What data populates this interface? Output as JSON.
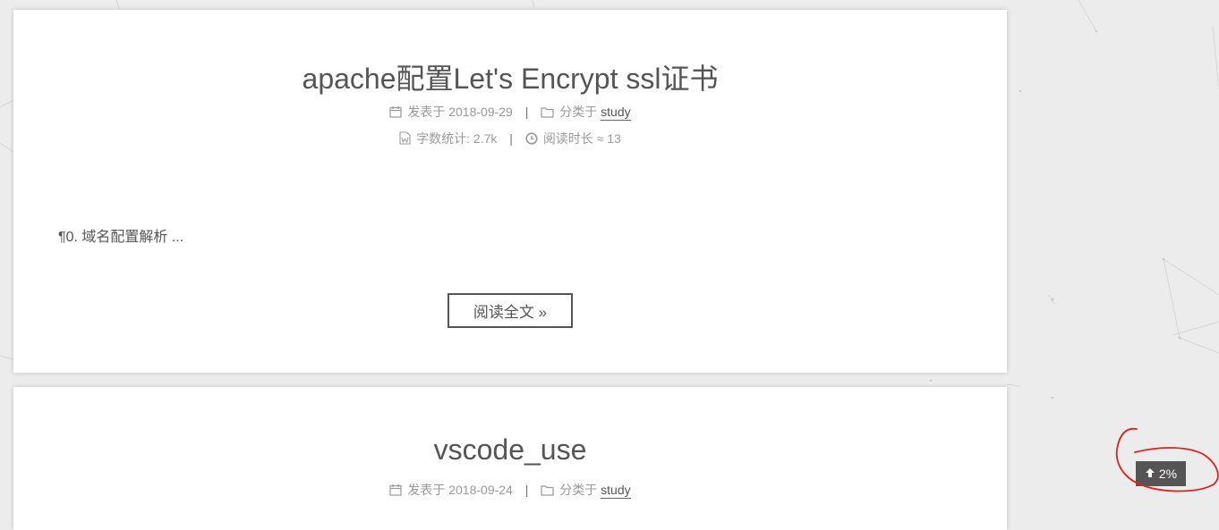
{
  "posts": [
    {
      "title": "apache配置Let's Encrypt ssl证书",
      "posted_label": "发表于",
      "posted_date": "2018-09-29",
      "category_label": "分类于",
      "category": "study",
      "wordcount_label": "字数统计:",
      "wordcount": "2.7k",
      "readtime_label": "阅读时长 ≈",
      "readtime": "13",
      "excerpt": "¶0. 域名配置解析 ...",
      "read_more": "阅读全文 »"
    },
    {
      "title": "vscode_use",
      "posted_label": "发表于",
      "posted_date": "2018-09-24",
      "category_label": "分类于",
      "category": "study"
    }
  ],
  "meta_separator": "|",
  "back_to_top": {
    "percent": "2%",
    "icon": "arrow-up-icon"
  },
  "colors": {
    "background": "#ececec",
    "card": "#ffffff",
    "text": "#555555",
    "meta": "#999999",
    "back_to_top_bg": "#555555",
    "annotation": "#e0201f"
  },
  "icons": [
    "calendar-icon",
    "folder-icon",
    "file-word-icon",
    "clock-icon",
    "arrow-up-icon"
  ]
}
